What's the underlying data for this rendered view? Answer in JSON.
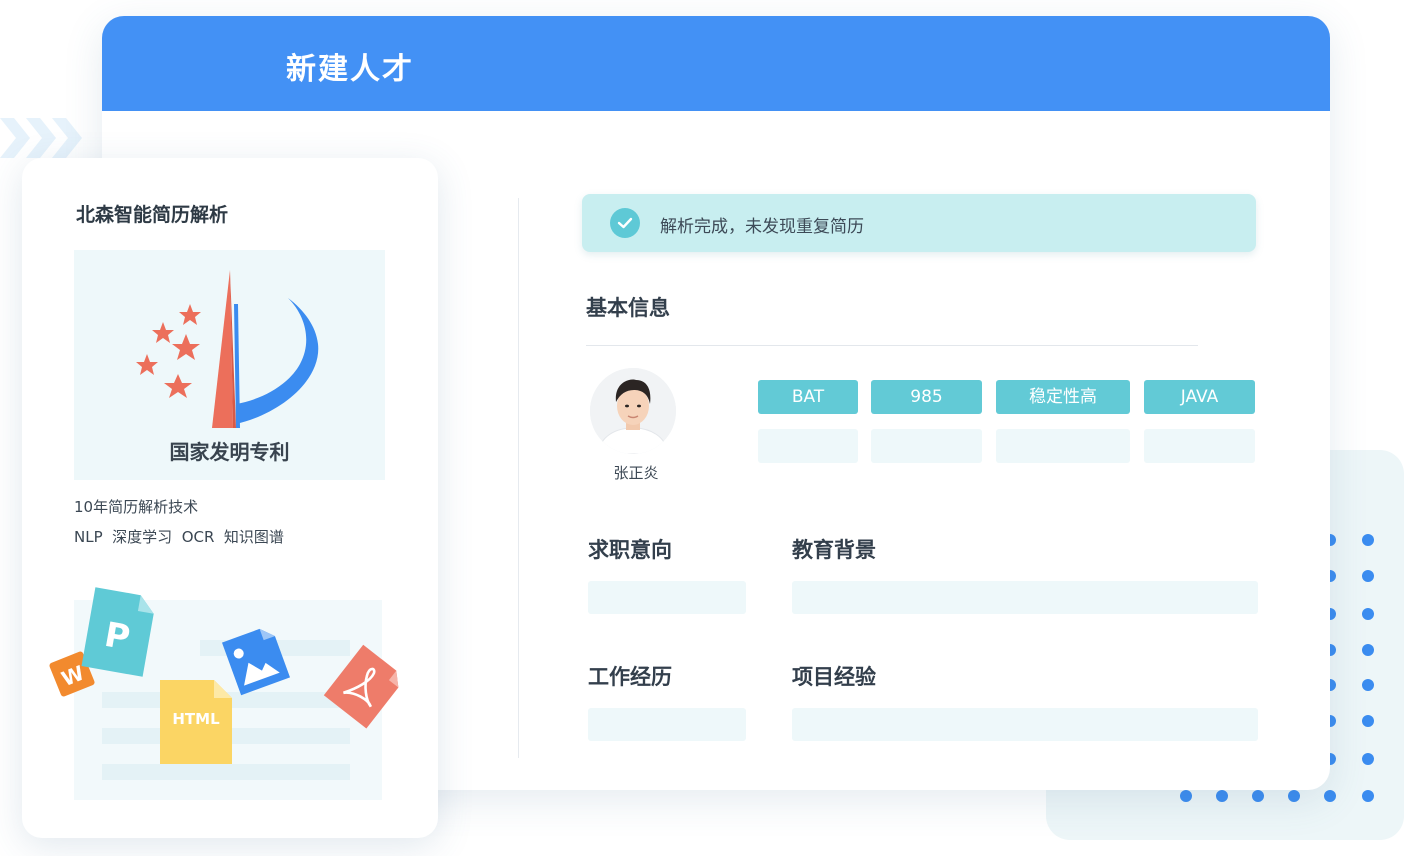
{
  "window": {
    "title": "新建人才"
  },
  "left_card": {
    "title": "北森智能简历解析",
    "patent_caption": "国家发明专利",
    "lines": [
      "10年简历解析技术",
      "NLP  深度学习  OCR  知识图谱"
    ],
    "file_icons": [
      {
        "name": "word",
        "label": "W",
        "color": "#f28a2e"
      },
      {
        "name": "ppt",
        "label": "P",
        "color": "#5fcad6"
      },
      {
        "name": "image",
        "label": "",
        "color": "#3b8cf0"
      },
      {
        "name": "html",
        "label": "HTML",
        "color": "#fbd564"
      },
      {
        "name": "pdf",
        "label": "",
        "color": "#ee7c6a"
      }
    ]
  },
  "banner": {
    "text": "解析完成，未发现重复简历"
  },
  "sections": {
    "basic_info": "基本信息",
    "job_intention": "求职意向",
    "education": "教育背景",
    "work_experience": "工作经历",
    "project_experience": "项目经验"
  },
  "candidate": {
    "name": "张正炎"
  },
  "tags": [
    "BAT",
    "985",
    "稳定性高",
    "JAVA"
  ],
  "colors": {
    "header_blue": "#4391f5",
    "tag_teal": "#62cad6",
    "banner_bg": "#c8eef0",
    "star_red": "#ec6f5b"
  }
}
